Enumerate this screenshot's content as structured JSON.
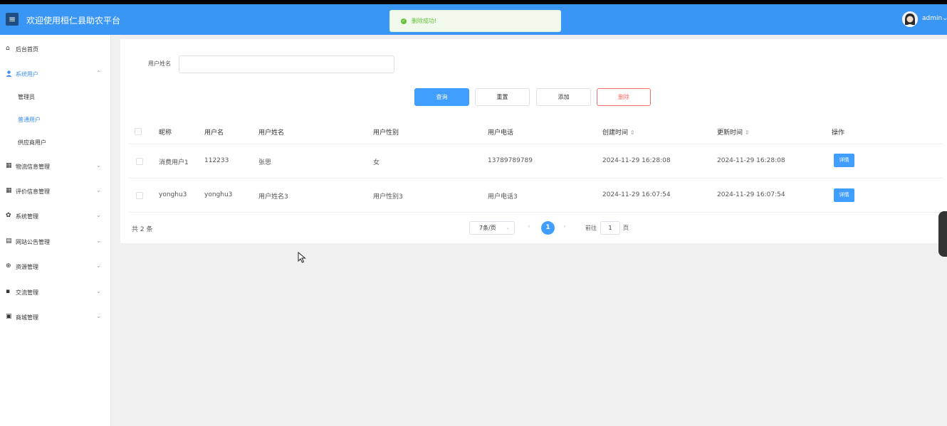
{
  "header": {
    "menu_icon": "hamburger-icon",
    "title": "欢迎使用桓仁县助农平台",
    "user": "admin",
    "user_caret": "⌄",
    "bg_color": "#3a96f5"
  },
  "toast": {
    "icon": "success-check-icon",
    "text": "删除成功!",
    "color": "#67c23a"
  },
  "sidebar": {
    "items": [
      {
        "label": "后台首页",
        "icon": "home-icon"
      },
      {
        "label": "系统用户",
        "icon": "user-icon",
        "arrow": "⌃"
      },
      {
        "label": "物流信息管理",
        "icon": "grid-icon",
        "arrow": "⌄"
      },
      {
        "label": "评价信息管理",
        "icon": "grid-icon",
        "arrow": "⌄"
      },
      {
        "label": "系统管理",
        "icon": "gear-icon",
        "arrow": "⌄"
      },
      {
        "label": "网站公告管理",
        "icon": "document-icon",
        "arrow": "⌄"
      },
      {
        "label": "资源管理",
        "icon": "plus-circle-icon",
        "arrow": "⌄"
      },
      {
        "label": "交流管理",
        "icon": "message-icon",
        "arrow": "⌄"
      },
      {
        "label": "商城管理",
        "icon": "shop-icon",
        "arrow": "⌄"
      }
    ],
    "sub_items": [
      {
        "label": "管理员"
      },
      {
        "label": "普通用户"
      },
      {
        "label": "供应商用户"
      }
    ]
  },
  "search": {
    "label": "用户姓名",
    "value": "",
    "placeholder": ""
  },
  "buttons": {
    "query": "查询",
    "reset": "重置",
    "add": "添加",
    "delete": "删除"
  },
  "table": {
    "headers": [
      "昵称",
      "用户名",
      "用户姓名",
      "用户性别",
      "用户电话",
      "创建时间",
      "更新时间",
      "操作"
    ],
    "sort_icon": "⇕",
    "rows": [
      {
        "nickname": "消费用户1",
        "username": "112233",
        "realname": "张思",
        "gender": "女",
        "phone": "13789789789",
        "created": "2024-11-29 16:28:08",
        "updated": "2024-11-29 16:28:08",
        "action": "详情"
      },
      {
        "nickname": "yonghu3",
        "username": "yonghu3",
        "realname": "用户姓名3",
        "gender": "用户性别3",
        "phone": "用户电话3",
        "created": "2024-11-29 16:07:54",
        "updated": "2024-11-29 16:07:54",
        "action": "详情"
      }
    ]
  },
  "pagination": {
    "total": "共 2 条",
    "page_size": "7条/页",
    "current_page": "1",
    "prev": "‹",
    "next": "›",
    "goto_label": "前往",
    "goto_value": "1",
    "goto_suffix": "页"
  }
}
